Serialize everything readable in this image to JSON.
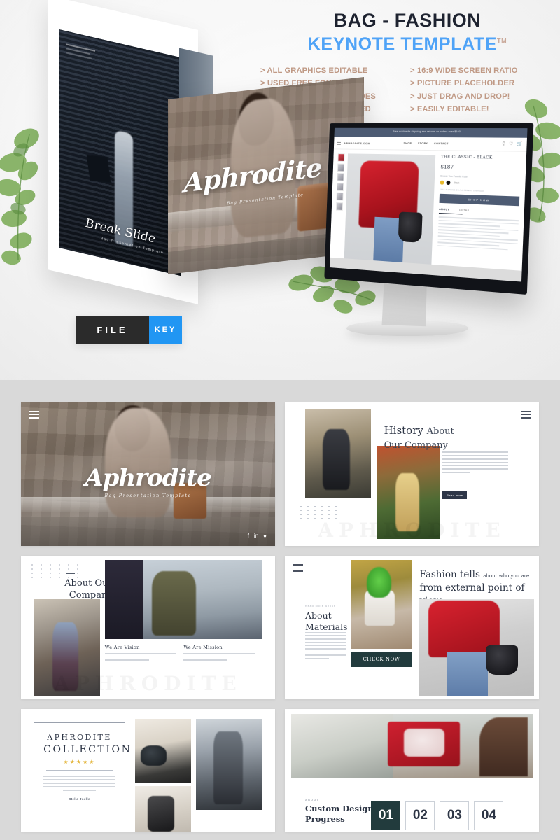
{
  "hero": {
    "headline_1": "BAG - FASHION",
    "headline_2": "KEYNOTE  TEMPLATE",
    "headline_tm": "TM",
    "features_left": [
      "> ALL GRAPHICS EDITABLE",
      "> USED FREE FONTS",
      "> BASED ON MASTER SLIDES",
      ">  VECTOR ICONS INCLUDED"
    ],
    "features_right": [
      "> 16:9 WIDE SCREEN RATIO",
      "> PICTURE PLACEHOLDER",
      "> JUST DRAG AND DROP!",
      "> EASILY EDITABLE!"
    ],
    "break_slide_title": "Break Slide",
    "break_slide_sub": "Bag Presentation Template",
    "main_slide_title": "Aphrodite",
    "main_slide_sub": "Bag Presentation Template",
    "badge": {
      "file": "FILE",
      "key": "KEY"
    }
  },
  "browser": {
    "promo_bar": "Free worldwide shipping and returns on orders over $100",
    "logo": "APHRODITE.COM",
    "menu": [
      "SHOP",
      "STORY",
      "CONTACT"
    ],
    "icons": [
      "search-icon",
      "heart-icon",
      "cart-icon"
    ],
    "product_title": "THE CLASSIC - BLACK",
    "price": "$187",
    "choose_label": "Choose Your Favorite Color",
    "color_label": "Black",
    "swatch_colors": [
      "#e8b92a",
      "#111111"
    ],
    "shipping_note": "FREE SHIPPING ON ALL ORDERS OVER $100",
    "cta": "SHOP NOW",
    "tabs": [
      "ABOUT",
      "DETAIL"
    ]
  },
  "gallery": {
    "slide1": {
      "title": "Aphrodite",
      "subtitle": "Bag Presentation Template",
      "social": [
        "facebook-icon",
        "linkedin-icon",
        "twitter-icon"
      ]
    },
    "slide2": {
      "title_strong": "History",
      "title_light": "About",
      "title_line2": "Our Company",
      "button": "Read more",
      "watermark": "APHRODITE"
    },
    "slide3": {
      "title_line1": "About Our",
      "title_line2": "Company",
      "col1_heading": "We Are Vision",
      "col2_heading": "We Are Mission",
      "watermark": "APHRODITE"
    },
    "slide4": {
      "kicker": "Read More About",
      "title_line1": "About",
      "title_line2": "Materials",
      "button": "CHECK NOW",
      "head_strong": "Fashion tells",
      "head_small": "about who you are",
      "head_line2": "from external point of view"
    },
    "slide5": {
      "title_line1": "APHRODITE",
      "title_line2": "COLLECTION",
      "stars": "★★★★★",
      "signature": "Stella Joelle"
    },
    "slide6": {
      "kicker": "ABOUT",
      "title_line1": "Custom Design",
      "title_line2": "Progress",
      "steps": [
        "01",
        "02",
        "03",
        "04"
      ],
      "active_step": "01"
    }
  },
  "colors": {
    "accent_blue": "#2196f3",
    "headline_blue": "#4fa3f7",
    "feature_tan": "#c09a86",
    "dark_navy": "#2d3545",
    "gallery_bg": "#d9d9d9",
    "teal_dark": "#223b3d",
    "star_gold": "#e3b53a"
  }
}
